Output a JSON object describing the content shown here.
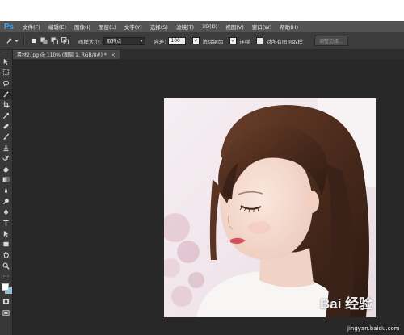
{
  "app": {
    "logo": "Ps"
  },
  "menu": [
    "文件(F)",
    "编辑(E)",
    "图像(I)",
    "图层(L)",
    "文字(Y)",
    "选择(S)",
    "滤镜(T)",
    "3D(D)",
    "视图(V)",
    "窗口(W)",
    "帮助(H)"
  ],
  "options": {
    "brush_size_label": "画样大小:",
    "brush_size_value": "取样点",
    "tolerance_label": "容差:",
    "tolerance_value": "100",
    "anti_alias_label": "消除锯齿",
    "anti_alias_checked": true,
    "contiguous_label": "连续",
    "contiguous_checked": true,
    "sample_all_label": "对所有图层取样",
    "sample_all_checked": false,
    "refine_edge_button": "调整边缘..."
  },
  "document": {
    "tab_title": "素材2.jpg @ 110% (图层 1, RGB/8#) *",
    "close": "×"
  },
  "toolbar": {
    "tools": [
      "move-icon",
      "marquee-icon",
      "lasso-icon",
      "magic-wand-icon",
      "crop-icon",
      "eyedropper-icon",
      "healing-icon",
      "brush-icon",
      "stamp-icon",
      "history-brush-icon",
      "eraser-icon",
      "gradient-icon",
      "blur-icon",
      "dodge-icon",
      "pen-icon",
      "type-icon",
      "path-select-icon",
      "shape-icon",
      "hand-icon",
      "zoom-icon"
    ],
    "active_tool": 3,
    "foreground_color": "#ffffff",
    "background_color": "#7ec8e3"
  },
  "watermark": {
    "brand": "Bai 经验",
    "url": "jingyan.baidu.com"
  }
}
